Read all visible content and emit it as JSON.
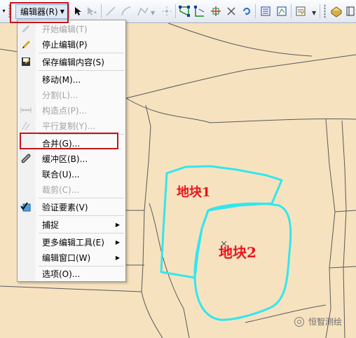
{
  "toolbar": {
    "editor_label": "编辑器(R)",
    "tools": [
      "grip-icon",
      "editor-menu",
      "edit-tool-icon",
      "annotation-edit-icon",
      "straight-segment-icon",
      "endpoint-arc-icon",
      "trace-icon",
      "point-icon",
      "vertices-icon",
      "reshape-icon",
      "cut-polygon-icon",
      "split-icon",
      "rotate-icon",
      "attributes-icon",
      "sketch-properties-icon",
      "create-features-icon",
      "overflow-icon",
      "topology-icon"
    ]
  },
  "menu": {
    "items": [
      {
        "label": "开始编辑(T)",
        "enabled": false,
        "icon": "pencil-icon"
      },
      {
        "label": "停止编辑(P)",
        "enabled": true,
        "icon": "stop-pencil-icon"
      },
      {
        "label": "保存编辑内容(S)",
        "enabled": true,
        "icon": "save-edits-icon"
      },
      {
        "label": "移动(M)...",
        "enabled": true,
        "icon": ""
      },
      {
        "label": "分割(L)...",
        "enabled": false,
        "icon": ""
      },
      {
        "label": "构造点(P)...",
        "enabled": false,
        "icon": "construct-points-icon"
      },
      {
        "label": "平行复制(Y)...",
        "enabled": false,
        "icon": "copy-parallel-icon"
      },
      {
        "label": "合并(G)...",
        "enabled": true,
        "icon": ""
      },
      {
        "label": "缓冲区(B)...",
        "enabled": true,
        "icon": "buffer-icon"
      },
      {
        "label": "联合(U)...",
        "enabled": true,
        "icon": ""
      },
      {
        "label": "裁剪(C)...",
        "enabled": false,
        "icon": ""
      },
      {
        "label": "验证要素(V)",
        "enabled": true,
        "icon": "validate-features-icon"
      },
      {
        "label": "捕捉",
        "enabled": true,
        "icon": "",
        "submenu": true
      },
      {
        "label": "更多编辑工具(E)",
        "enabled": true,
        "icon": "",
        "submenu": true
      },
      {
        "label": "编辑窗口(W)",
        "enabled": true,
        "icon": "",
        "submenu": true
      },
      {
        "label": "选项(O)...",
        "enabled": true,
        "icon": ""
      }
    ]
  },
  "map": {
    "parcel1_label": "地块1",
    "parcel2_label": "地块2"
  },
  "watermark": {
    "text": "恒智测绘"
  },
  "colors": {
    "map_fill": "#f7e2bf",
    "parcel_line": "#4f4f4f",
    "selection": "#33e6ee",
    "highlight": "#c0161c",
    "label": "#e8141e"
  }
}
